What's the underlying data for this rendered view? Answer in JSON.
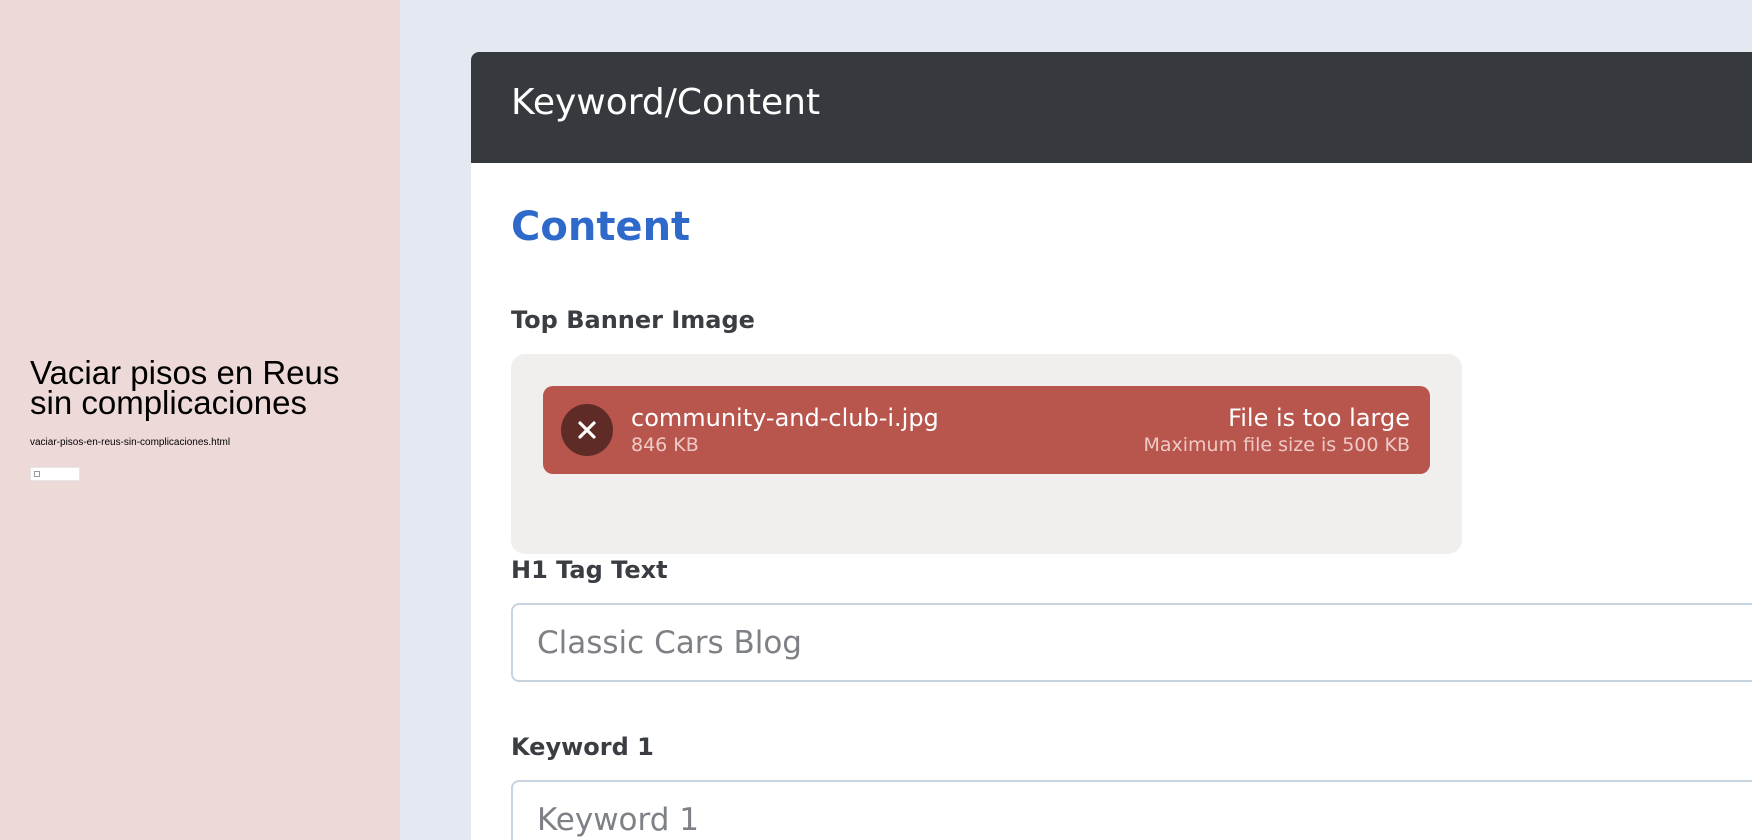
{
  "left_panel": {
    "title": "Vaciar pisos en Reus sin complicaciones",
    "filename": "vaciar-pisos-en-reus-sin-complicaciones.html"
  },
  "card": {
    "header_title": "Keyword/Content",
    "section_title": "Content"
  },
  "banner": {
    "label": "Top Banner Image",
    "file": {
      "name": "community-and-club-i.jpg",
      "size": "846 KB",
      "status": "File is too large",
      "status_detail": "Maximum file size is 500 KB"
    },
    "icons": {
      "remove": "close-icon"
    },
    "colors": {
      "error_bg": "#b8564e",
      "remove_bg": "#5f2b26"
    }
  },
  "h1": {
    "label": "H1 Tag Text",
    "placeholder": "Classic Cars Blog",
    "value": ""
  },
  "keyword1": {
    "label": "Keyword 1",
    "placeholder": "Keyword 1",
    "value": ""
  },
  "colors": {
    "accent": "#2f6acb",
    "header_bg": "#363a3e",
    "page_bg": "#e4e8f1",
    "left_panel_bg": "#eed9d9"
  }
}
